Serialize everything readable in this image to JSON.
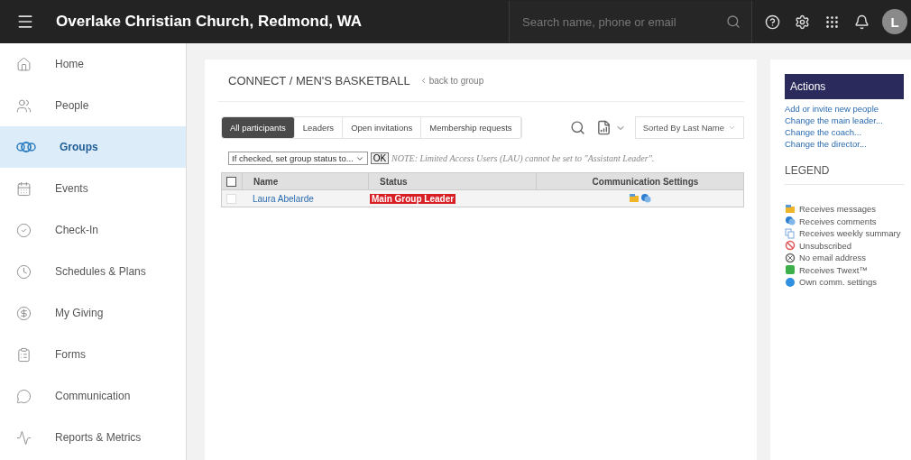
{
  "topbar": {
    "title": "Overlake Christian Church, Redmond, WA",
    "search": {
      "placeholder": "Search name, phone or email"
    },
    "avatar": "L"
  },
  "sidebar": {
    "items": [
      {
        "label": "Home",
        "kind": "home",
        "selected": false
      },
      {
        "label": "People",
        "kind": "people",
        "selected": false
      },
      {
        "label": "Groups",
        "kind": "groups",
        "selected": true
      },
      {
        "label": "Events",
        "kind": "events",
        "selected": false
      },
      {
        "label": "Check-In",
        "kind": "checkin",
        "selected": false
      },
      {
        "label": "Schedules & Plans",
        "kind": "schedules",
        "selected": false
      },
      {
        "label": "My Giving",
        "kind": "giving",
        "selected": false
      },
      {
        "label": "Forms",
        "kind": "forms",
        "selected": false
      },
      {
        "label": "Communication",
        "kind": "communication",
        "selected": false
      },
      {
        "label": "Reports & Metrics",
        "kind": "reports",
        "selected": false
      }
    ]
  },
  "main": {
    "breadcrumb": "CONNECT / MEN'S BASKETBALL",
    "back_link": "back to group",
    "tabs": [
      {
        "label": "All participants",
        "selected": true
      },
      {
        "label": "Leaders",
        "selected": false
      },
      {
        "label": "Open invitations",
        "selected": false
      },
      {
        "label": "Membership requests",
        "selected": false
      }
    ],
    "sort": "Sorted By Last Name",
    "bulk": {
      "select": "If checked, set group status to...",
      "ok": "OK",
      "note": "NOTE: Limited Access Users (LAU) cannot be set to \"Assistant Leader\"."
    },
    "table": {
      "columns": [
        "Name",
        "Status",
        "Communication Settings"
      ],
      "header_checked": false,
      "rows": [
        {
          "name": "Laura Abelarde",
          "status": "Main Group Leader",
          "checked": false,
          "receives_messages": true,
          "receives_comments": true
        }
      ]
    }
  },
  "actions": {
    "title": "Actions",
    "links": [
      "Add or invite new people",
      "Change the main leader...",
      "Change the coach...",
      "Change the director..."
    ],
    "legend_title": "LEGEND",
    "legend": [
      {
        "kind": "messages",
        "label": "Receives messages"
      },
      {
        "kind": "comments",
        "label": "Receives comments"
      },
      {
        "kind": "weekly",
        "label": "Receives weekly summary"
      },
      {
        "kind": "unsubscribed",
        "label": "Unsubscribed"
      },
      {
        "kind": "noemail",
        "label": "No email address"
      },
      {
        "kind": "twext",
        "label": "Receives Twext™"
      },
      {
        "kind": "own",
        "label": "Own comm. settings"
      }
    ]
  }
}
